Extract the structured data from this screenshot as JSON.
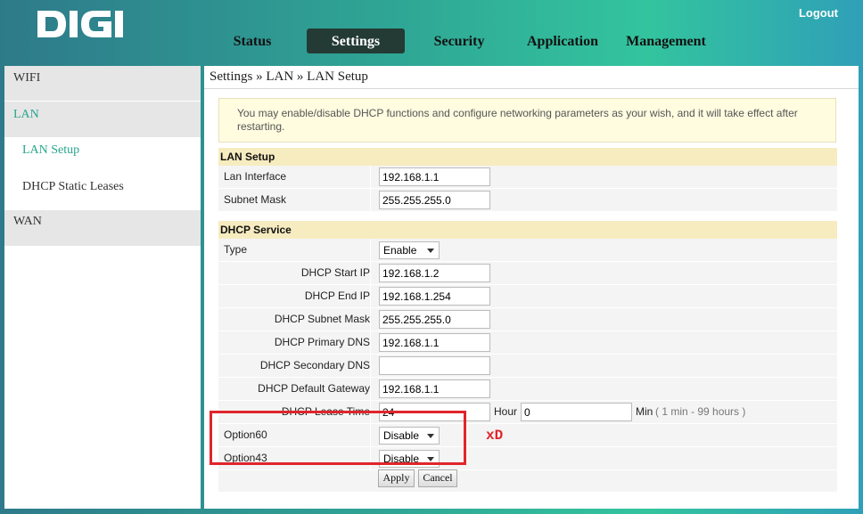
{
  "brand": {
    "logo_text": "DIGI"
  },
  "header": {
    "logout": "Logout"
  },
  "nav": [
    {
      "label": "Status"
    },
    {
      "label": "Settings",
      "active": true
    },
    {
      "label": "Security"
    },
    {
      "label": "Application"
    },
    {
      "label": "Management"
    }
  ],
  "sidebar": {
    "wifi": "WIFI",
    "lan": "LAN",
    "lan_setup": "LAN Setup",
    "dhcp_static": "DHCP Static Leases",
    "wan": "WAN"
  },
  "breadcrumb": "Settings » LAN » LAN Setup",
  "info": "You may enable/disable DHCP functions and configure networking parameters as your wish, and it will take effect after restarting.",
  "lan_setup": {
    "title": "LAN Setup",
    "lan_interface": {
      "label": "Lan Interface",
      "value": "192.168.1.1"
    },
    "subnet_mask": {
      "label": "Subnet Mask",
      "value": "255.255.255.0"
    }
  },
  "dhcp": {
    "title": "DHCP Service",
    "type": {
      "label": "Type",
      "value": "Enable"
    },
    "start_ip": {
      "label": "DHCP Start IP",
      "value": "192.168.1.2"
    },
    "end_ip": {
      "label": "DHCP End IP",
      "value": "192.168.1.254"
    },
    "subnet_mask": {
      "label": "DHCP Subnet Mask",
      "value": "255.255.255.0"
    },
    "primary_dns": {
      "label": "DHCP Primary DNS",
      "value": "192.168.1.1"
    },
    "secondary_dns": {
      "label": "DHCP Secondary DNS",
      "value": ""
    },
    "default_gateway": {
      "label": "DHCP Default Gateway",
      "value": "192.168.1.1"
    },
    "lease_time": {
      "label": "DHCP Lease Time",
      "hours": "24",
      "hour_unit": "Hour",
      "minutes": "0",
      "min_unit": "Min",
      "hint": "( 1 min - 99 hours )"
    },
    "option60": {
      "label": "Option60",
      "value": "Disable"
    },
    "option43": {
      "label": "Option43",
      "value": "Disable"
    }
  },
  "buttons": {
    "apply": "Apply",
    "cancel": "Cancel"
  },
  "annotation": {
    "text": "xD",
    "color": "#e0252b"
  },
  "colors": {
    "active_nav": "#243b35",
    "sidebar_active": "#27a58c",
    "section_header": "#f7ecc0",
    "info_bg": "#fffce0"
  }
}
